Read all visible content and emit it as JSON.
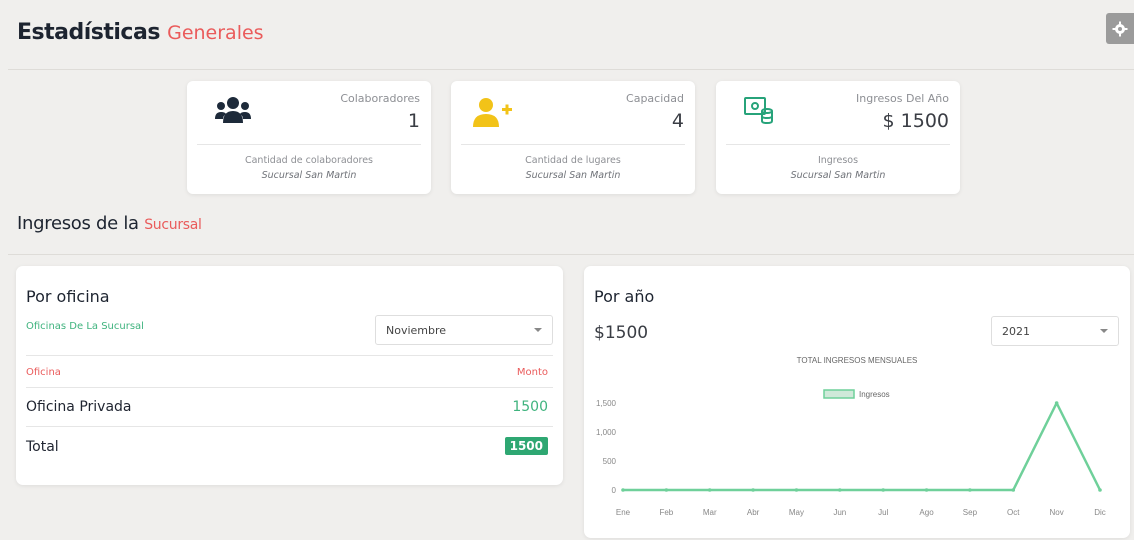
{
  "header": {
    "title": "Estadísticas",
    "title_accent": "Generales"
  },
  "colors": {
    "accent": "#ea5b5b",
    "green": "#3fb37e",
    "badge": "#2ea772",
    "icon_navy": "#1d2a3a",
    "icon_yellow": "#f2c318",
    "icon_teal": "#27a37a"
  },
  "stats": [
    {
      "icon": "users-icon",
      "label": "Colaboradores",
      "value": "1",
      "description": "Cantidad de colaboradores",
      "branch": "Sucursal San Martin"
    },
    {
      "icon": "user-plus-icon",
      "label": "Capacidad",
      "value": "4",
      "description": "Cantidad de lugares",
      "branch": "Sucursal San Martin"
    },
    {
      "icon": "money-coins-icon",
      "label": "Ingresos Del Año",
      "value": "$ 1500",
      "description": "Ingresos",
      "branch": "Sucursal San Martin"
    }
  ],
  "section": {
    "title": "Ingresos de la",
    "title_accent": "Sucursal"
  },
  "por_oficina": {
    "title": "Por oficina",
    "subtitle": "Oficinas De La Sucursal",
    "month_select": "Noviembre",
    "columns": [
      "Oficina",
      "Monto"
    ],
    "rows": [
      {
        "name": "Oficina Privada",
        "amount": "1500"
      }
    ],
    "total_label": "Total",
    "total_value": "1500"
  },
  "por_anio": {
    "title": "Por año",
    "amount": "$1500",
    "year_select": "2021"
  },
  "chart_data": {
    "type": "line",
    "title": "TOTAL INGRESOS MENSUALES",
    "categories": [
      "Ene",
      "Feb",
      "Mar",
      "Abr",
      "May",
      "Jun",
      "Jul",
      "Ago",
      "Sep",
      "Oct",
      "Nov",
      "Dic"
    ],
    "series": [
      {
        "name": "Ingresos",
        "values": [
          0,
          0,
          0,
          0,
          0,
          0,
          0,
          0,
          0,
          0,
          1500,
          0
        ],
        "color": "#6fd09a"
      }
    ],
    "yticks": [
      "0",
      "500",
      "1,000",
      "1,500"
    ],
    "ylim": [
      0,
      1500
    ],
    "legend": "top"
  }
}
